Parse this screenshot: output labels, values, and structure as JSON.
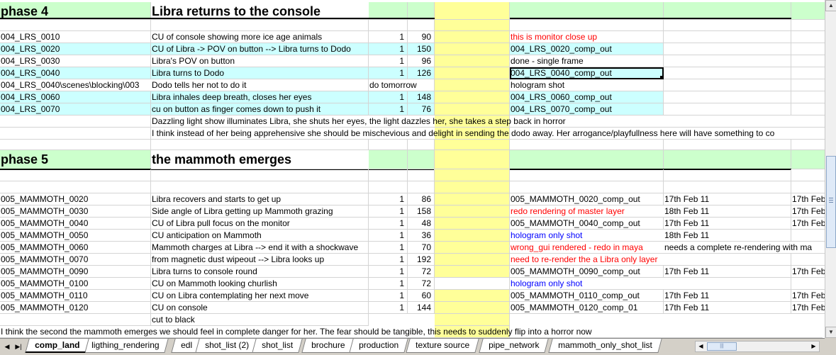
{
  "phase4": {
    "label": "phase 4",
    "title": "Libra returns to the console",
    "rows": [
      {
        "shot": "004_LRS_0010",
        "desc": "CU of console showing more ice age animals",
        "n": "1",
        "frames": "90",
        "note": "this is monitor close up",
        "note_color": "red",
        "cyan": false
      },
      {
        "shot": "004_LRS_0020",
        "desc": "CU of Libra -> POV on button --> Libra turns to Dodo",
        "n": "1",
        "frames": "150",
        "note": "004_LRS_0020_comp_out",
        "note_color": "black",
        "cyan": true
      },
      {
        "shot": "004_LRS_0030",
        "desc": "Libra's POV on button",
        "n": "1",
        "frames": "96",
        "note": "done - single frame",
        "note_color": "black",
        "cyan": false
      },
      {
        "shot": "004_LRS_0040",
        "desc": "Libra turns to Dodo",
        "n": "1",
        "frames": "126",
        "note": "004_LRS_0040_comp_out",
        "note_color": "black",
        "cyan": true
      },
      {
        "shot": "004_LRS_0040\\scenes\\blocking\\003",
        "desc": "Dodo tells her not to do it",
        "extra": "do tomorrow",
        "n": "",
        "frames": "",
        "note": "hologram shot",
        "note_color": "black",
        "cyan": false
      },
      {
        "shot": "004_LRS_0060",
        "desc": "Libra inhales deep breath, closes her eyes",
        "n": "1",
        "frames": "148",
        "note": "004_LRS_0060_comp_out",
        "note_color": "black",
        "cyan": true
      },
      {
        "shot": "004_LRS_0070",
        "desc": "cu on button as finger comes down to push it",
        "n": "1",
        "frames": "76",
        "note": "004_LRS_0070_comp_out",
        "note_color": "black",
        "cyan": true
      }
    ],
    "comment1": "Dazzling light show illuminates Libra, she shuts her eyes, the light dazzles her, she takes a step back in horror",
    "comment2": "I think instead of her being apprehensive she should be mischevious and delight in sending the dodo away.  Her arrogance/playfullness here will have something to co"
  },
  "phase5": {
    "label": "phase 5",
    "title": "the mammoth emerges",
    "rows": [
      {
        "shot": "005_MAMMOTH_0020",
        "desc": "Libra recovers and starts to get up",
        "n": "1",
        "frames": "86",
        "note": "005_MAMMOTH_0020_comp_out",
        "note_color": "black",
        "date": "17th Feb 11",
        "date2": "17th Feb"
      },
      {
        "shot": "005_MAMMOTH_0030",
        "desc": "Side angle of Libra getting up Mammoth grazing",
        "n": "1",
        "frames": "158",
        "note": "redo rendering of master layer",
        "note_color": "red",
        "date": "18th Feb 11",
        "date2": "17th Feb"
      },
      {
        "shot": "005_MAMMOTH_0040",
        "desc": "CU of Libra pull focus on the monitor",
        "n": "1",
        "frames": "48",
        "note": "005_MAMMOTH_0040_comp_out",
        "note_color": "black",
        "date": "17th Feb 11",
        "date2": "17th Feb"
      },
      {
        "shot": "005_MAMMOTH_0050",
        "desc": "CU anticipation on Mammoth",
        "n": "1",
        "frames": "36",
        "note": "hologram only shot",
        "note_color": "blue",
        "date": "18th Feb 11",
        "date2": ""
      },
      {
        "shot": "005_MAMMOTH_0060",
        "desc": "Mammoth charges at Libra --> end it with a shockwave",
        "n": "1",
        "frames": "70",
        "note": "wrong_gui rendered - redo in maya",
        "note_color": "red",
        "date": "needs a complete re-rendering with ma",
        "date2": ""
      },
      {
        "shot": "005_MAMMOTH_0070",
        "desc": "from magnetic dust wipeout --> Libra looks up",
        "n": "1",
        "frames": "192",
        "note": "need to re-render the a Libra only layer",
        "note_color": "red",
        "date": "",
        "date2": ""
      },
      {
        "shot": "005_MAMMOTH_0090",
        "desc": "Libra turns to console round",
        "n": "1",
        "frames": "72",
        "note": "005_MAMMOTH_0090_comp_out",
        "note_color": "black",
        "date": "17th Feb 11",
        "date2": "17th Feb"
      },
      {
        "shot": "005_MAMMOTH_0100",
        "desc": "CU on Mammoth looking churlish",
        "n": "1",
        "frames": "72",
        "note": "hologram only shot",
        "note_color": "blue",
        "date": "",
        "date2": "",
        "white_d": true
      },
      {
        "shot": "005_MAMMOTH_0110",
        "desc": "CU on Libra contemplating her next move",
        "n": "1",
        "frames": "60",
        "note": "005_MAMMOTH_0110_comp_out",
        "note_color": "black",
        "date": "17th Feb 11",
        "date2": "17th Feb"
      },
      {
        "shot": "005_MAMMOTH_0120",
        "desc": "CU on console",
        "n": "1",
        "frames": "144",
        "note": "005_MAMMOTH_0120_comp_01",
        "note_color": "black",
        "date": "17th Feb 11",
        "date2": "17th Feb"
      }
    ],
    "cut": "cut to black",
    "comment": "I think the second the mammoth emerges we should feel in complete danger for her.  The fear should be tangible, this needs to suddenly flip into a horror now"
  },
  "tabs": [
    "comp_land",
    "ligthing_rendering",
    "edl",
    "shot_list (2)",
    "shot_list",
    "brochure",
    "production",
    "texture source",
    "pipe_network",
    "mammoth_only_shot_list"
  ],
  "active_tab": "comp_land",
  "colors": {
    "highlight_green": "#ccffcc",
    "highlight_cyan": "#ccffff",
    "highlight_yellow": "#ffff99",
    "red_text": "#ff0000",
    "blue_text": "#0000ff"
  }
}
